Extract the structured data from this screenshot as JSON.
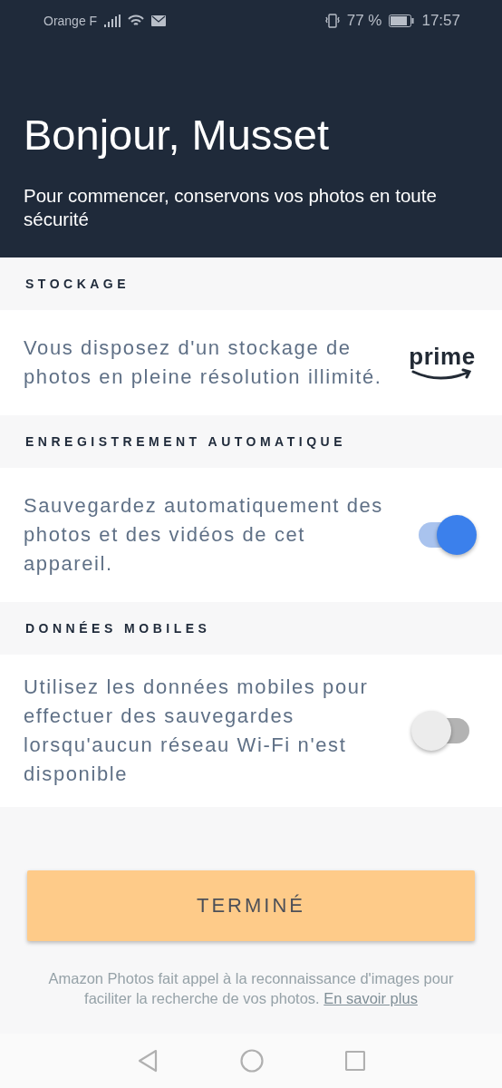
{
  "status_bar": {
    "carrier": "Orange F",
    "battery": "77 %",
    "time": "17:57"
  },
  "header": {
    "title": "Bonjour, Musset",
    "subtitle": "Pour commencer, conservons vos photos en toute sécurité"
  },
  "sections": [
    {
      "heading": "STOCKAGE",
      "kind": "logo",
      "text": "Vous disposez d'un stockage de photos en pleine résolution illimité.",
      "logo": "prime"
    },
    {
      "heading": "ENREGISTREMENT AUTOMATIQUE",
      "kind": "toggle",
      "text": "Sauvegardez automatiquement des photos et des vidéos de cet appareil.",
      "on": true
    },
    {
      "heading": "DONNÉES MOBILES",
      "kind": "toggle",
      "text": "Utilisez les données mobiles pour effectuer des sauvegardes lorsqu'aucun réseau Wi-Fi n'est disponible",
      "on": false
    }
  ],
  "done_button": "TERMINÉ",
  "footer": {
    "text": "Amazon Photos fait appel à la reconnaissance d'images pour faciliter la recherche de vos photos.",
    "link": "En savoir plus"
  }
}
